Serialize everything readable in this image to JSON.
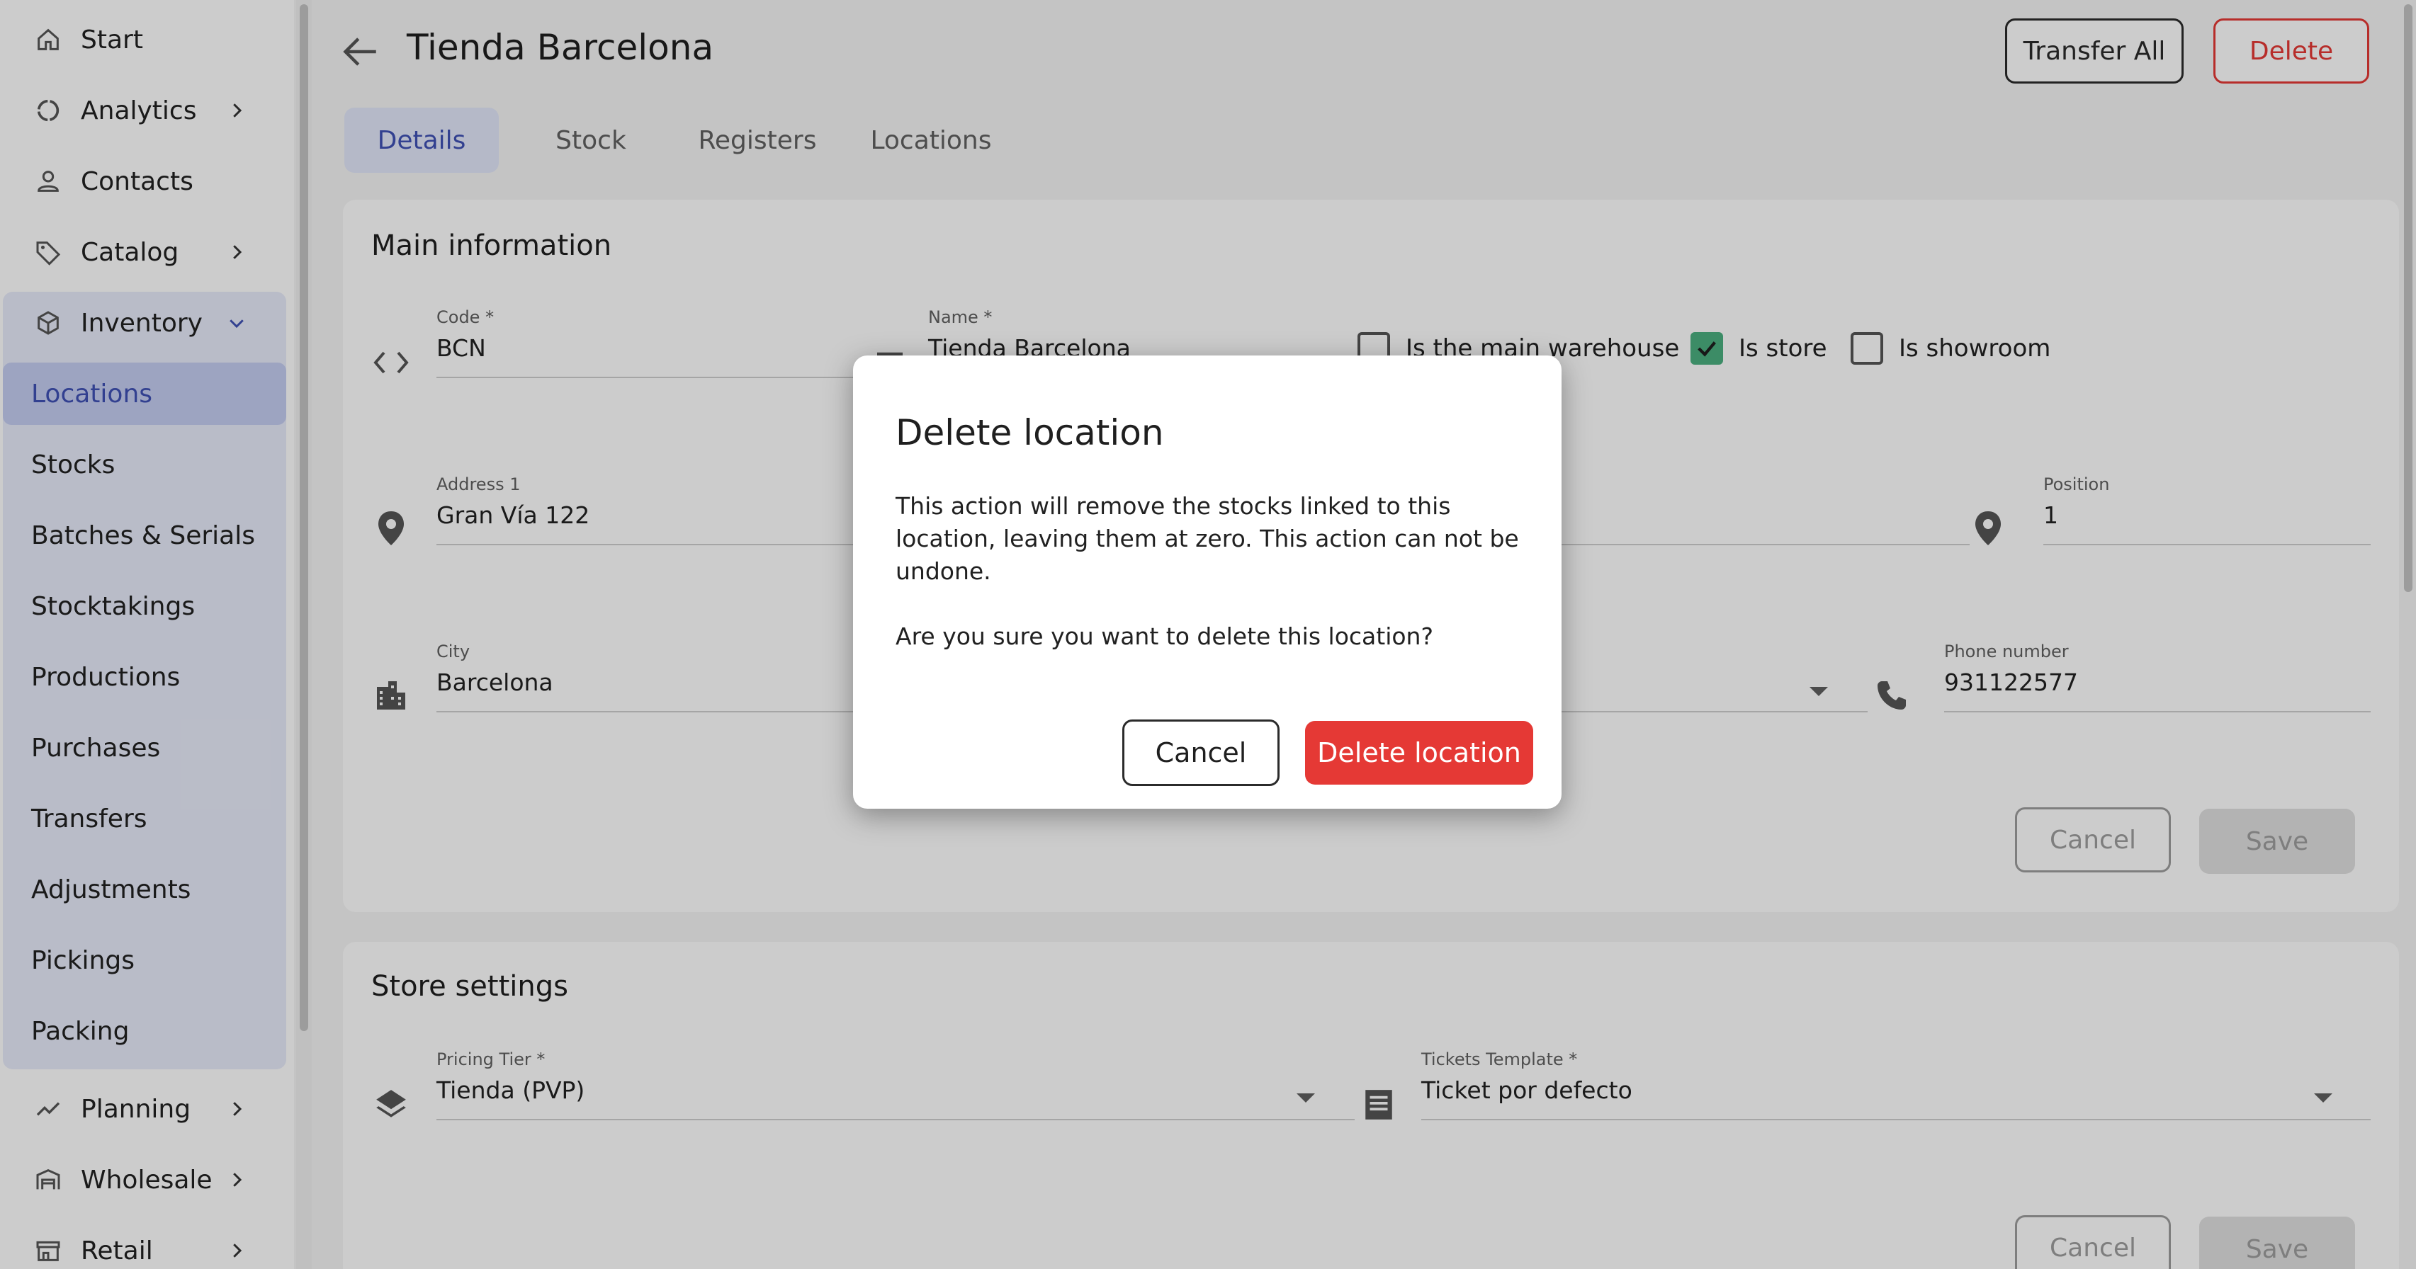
{
  "sidebar": {
    "start": "Start",
    "analytics": "Analytics",
    "contacts": "Contacts",
    "catalog": "Catalog",
    "inventory": "Inventory",
    "inventory_items": [
      "Locations",
      "Stocks",
      "Batches & Serials",
      "Stocktakings",
      "Productions",
      "Purchases",
      "Transfers",
      "Adjustments",
      "Pickings",
      "Packing"
    ],
    "planning": "Planning",
    "wholesale": "Wholesale",
    "retail": "Retail"
  },
  "header": {
    "title": "Tienda Barcelona",
    "transfer_all": "Transfer All",
    "delete": "Delete"
  },
  "tabs": [
    "Details",
    "Stock",
    "Registers",
    "Locations"
  ],
  "main_info": {
    "title": "Main information",
    "code_label": "Code *",
    "code_value": "BCN",
    "name_label": "Name *",
    "name_value": "Tienda Barcelona",
    "chk_main_warehouse": "Is the main warehouse",
    "chk_store": "Is store",
    "chk_showroom": "Is showroom",
    "address_label": "Address 1",
    "address_value": "Gran Vía 122",
    "position_label": "Position",
    "position_value": "1",
    "city_label": "City",
    "city_value": "Barcelona",
    "phone_label": "Phone number",
    "phone_value": "931122577",
    "cancel": "Cancel",
    "save": "Save"
  },
  "store_settings": {
    "title": "Store settings",
    "pricing_label": "Pricing Tier *",
    "pricing_value": "Tienda (PVP)",
    "tickets_label": "Tickets Template *",
    "tickets_value": "Ticket por defecto",
    "cancel": "Cancel",
    "save": "Save"
  },
  "dialog": {
    "title": "Delete location",
    "body1": "This action will remove the stocks linked to this location, leaving them at zero. This action can not be undone.",
    "body2": "Are you sure you want to delete this location?",
    "cancel": "Cancel",
    "confirm": "Delete location"
  },
  "colors": {
    "accent": "#3f51b5",
    "danger": "#e53935",
    "check": "#4caf80"
  }
}
